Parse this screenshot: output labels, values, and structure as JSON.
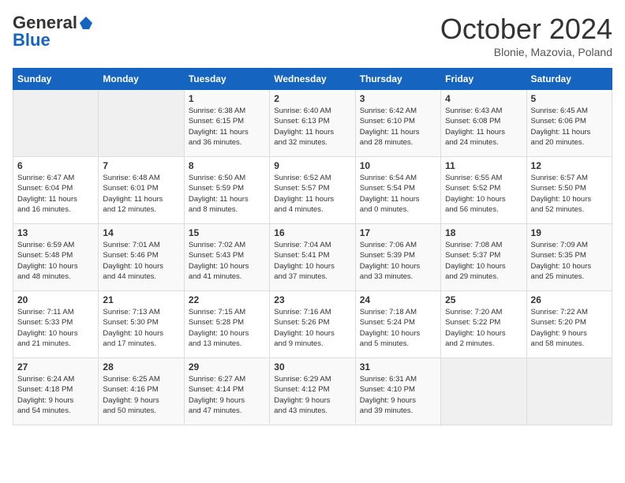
{
  "header": {
    "logo_general": "General",
    "logo_blue": "Blue",
    "month_title": "October 2024",
    "location": "Blonie, Mazovia, Poland"
  },
  "days_of_week": [
    "Sunday",
    "Monday",
    "Tuesday",
    "Wednesday",
    "Thursday",
    "Friday",
    "Saturday"
  ],
  "weeks": [
    [
      {
        "day": "",
        "info": ""
      },
      {
        "day": "",
        "info": ""
      },
      {
        "day": "1",
        "info": "Sunrise: 6:38 AM\nSunset: 6:15 PM\nDaylight: 11 hours\nand 36 minutes."
      },
      {
        "day": "2",
        "info": "Sunrise: 6:40 AM\nSunset: 6:13 PM\nDaylight: 11 hours\nand 32 minutes."
      },
      {
        "day": "3",
        "info": "Sunrise: 6:42 AM\nSunset: 6:10 PM\nDaylight: 11 hours\nand 28 minutes."
      },
      {
        "day": "4",
        "info": "Sunrise: 6:43 AM\nSunset: 6:08 PM\nDaylight: 11 hours\nand 24 minutes."
      },
      {
        "day": "5",
        "info": "Sunrise: 6:45 AM\nSunset: 6:06 PM\nDaylight: 11 hours\nand 20 minutes."
      }
    ],
    [
      {
        "day": "6",
        "info": "Sunrise: 6:47 AM\nSunset: 6:04 PM\nDaylight: 11 hours\nand 16 minutes."
      },
      {
        "day": "7",
        "info": "Sunrise: 6:48 AM\nSunset: 6:01 PM\nDaylight: 11 hours\nand 12 minutes."
      },
      {
        "day": "8",
        "info": "Sunrise: 6:50 AM\nSunset: 5:59 PM\nDaylight: 11 hours\nand 8 minutes."
      },
      {
        "day": "9",
        "info": "Sunrise: 6:52 AM\nSunset: 5:57 PM\nDaylight: 11 hours\nand 4 minutes."
      },
      {
        "day": "10",
        "info": "Sunrise: 6:54 AM\nSunset: 5:54 PM\nDaylight: 11 hours\nand 0 minutes."
      },
      {
        "day": "11",
        "info": "Sunrise: 6:55 AM\nSunset: 5:52 PM\nDaylight: 10 hours\nand 56 minutes."
      },
      {
        "day": "12",
        "info": "Sunrise: 6:57 AM\nSunset: 5:50 PM\nDaylight: 10 hours\nand 52 minutes."
      }
    ],
    [
      {
        "day": "13",
        "info": "Sunrise: 6:59 AM\nSunset: 5:48 PM\nDaylight: 10 hours\nand 48 minutes."
      },
      {
        "day": "14",
        "info": "Sunrise: 7:01 AM\nSunset: 5:46 PM\nDaylight: 10 hours\nand 44 minutes."
      },
      {
        "day": "15",
        "info": "Sunrise: 7:02 AM\nSunset: 5:43 PM\nDaylight: 10 hours\nand 41 minutes."
      },
      {
        "day": "16",
        "info": "Sunrise: 7:04 AM\nSunset: 5:41 PM\nDaylight: 10 hours\nand 37 minutes."
      },
      {
        "day": "17",
        "info": "Sunrise: 7:06 AM\nSunset: 5:39 PM\nDaylight: 10 hours\nand 33 minutes."
      },
      {
        "day": "18",
        "info": "Sunrise: 7:08 AM\nSunset: 5:37 PM\nDaylight: 10 hours\nand 29 minutes."
      },
      {
        "day": "19",
        "info": "Sunrise: 7:09 AM\nSunset: 5:35 PM\nDaylight: 10 hours\nand 25 minutes."
      }
    ],
    [
      {
        "day": "20",
        "info": "Sunrise: 7:11 AM\nSunset: 5:33 PM\nDaylight: 10 hours\nand 21 minutes."
      },
      {
        "day": "21",
        "info": "Sunrise: 7:13 AM\nSunset: 5:30 PM\nDaylight: 10 hours\nand 17 minutes."
      },
      {
        "day": "22",
        "info": "Sunrise: 7:15 AM\nSunset: 5:28 PM\nDaylight: 10 hours\nand 13 minutes."
      },
      {
        "day": "23",
        "info": "Sunrise: 7:16 AM\nSunset: 5:26 PM\nDaylight: 10 hours\nand 9 minutes."
      },
      {
        "day": "24",
        "info": "Sunrise: 7:18 AM\nSunset: 5:24 PM\nDaylight: 10 hours\nand 5 minutes."
      },
      {
        "day": "25",
        "info": "Sunrise: 7:20 AM\nSunset: 5:22 PM\nDaylight: 10 hours\nand 2 minutes."
      },
      {
        "day": "26",
        "info": "Sunrise: 7:22 AM\nSunset: 5:20 PM\nDaylight: 9 hours\nand 58 minutes."
      }
    ],
    [
      {
        "day": "27",
        "info": "Sunrise: 6:24 AM\nSunset: 4:18 PM\nDaylight: 9 hours\nand 54 minutes."
      },
      {
        "day": "28",
        "info": "Sunrise: 6:25 AM\nSunset: 4:16 PM\nDaylight: 9 hours\nand 50 minutes."
      },
      {
        "day": "29",
        "info": "Sunrise: 6:27 AM\nSunset: 4:14 PM\nDaylight: 9 hours\nand 47 minutes."
      },
      {
        "day": "30",
        "info": "Sunrise: 6:29 AM\nSunset: 4:12 PM\nDaylight: 9 hours\nand 43 minutes."
      },
      {
        "day": "31",
        "info": "Sunrise: 6:31 AM\nSunset: 4:10 PM\nDaylight: 9 hours\nand 39 minutes."
      },
      {
        "day": "",
        "info": ""
      },
      {
        "day": "",
        "info": ""
      }
    ]
  ]
}
